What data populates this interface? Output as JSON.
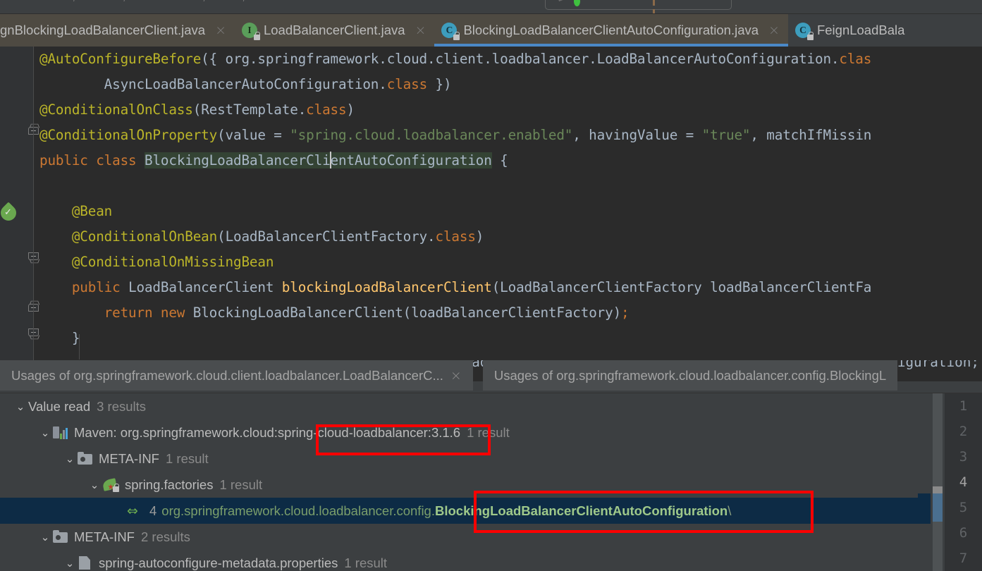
{
  "toolbar": {
    "breadcrumb_parts": [
      "/",
      "/",
      "/",
      "/",
      "/"
    ],
    "run_config_hint": "",
    "icons": [
      "bug-icon",
      "run-icon",
      "pause-icon",
      "chevron-down-icon",
      "minimize-icon"
    ]
  },
  "editor_tabs": [
    {
      "label": "gnBlockingLoadBalancerClient.java",
      "icon": "none",
      "close": "×",
      "active": false,
      "truncated_left": true
    },
    {
      "label": "LoadBalancerClient.java",
      "icon": "interface-icon",
      "close": "×",
      "active": false,
      "truncated_left": false
    },
    {
      "label": "BlockingLoadBalancerClientAutoConfiguration.java",
      "icon": "class-icon",
      "close": "×",
      "active": true,
      "truncated_left": false
    },
    {
      "label": "FeignLoadBala",
      "icon": "class-icon",
      "close": "",
      "active": false,
      "truncated_left": false
    }
  ],
  "code": {
    "lines": [
      [
        {
          "t": "@AutoConfigureBefore",
          "c": "ann"
        },
        {
          "t": "({ ",
          "c": "pn"
        },
        {
          "t": "org.springframework.cloud.client.loadbalancer.LoadBalancerAutoConfiguration",
          "c": "id"
        },
        {
          "t": ".",
          "c": "pn"
        },
        {
          "t": "clas",
          "c": "kw"
        }
      ],
      [
        {
          "t": "        ",
          "c": "pn"
        },
        {
          "t": "AsyncLoadBalancerAutoConfiguration",
          "c": "id"
        },
        {
          "t": ".",
          "c": "pn"
        },
        {
          "t": "class",
          "c": "kw"
        },
        {
          "t": " })",
          "c": "pn"
        }
      ],
      [
        {
          "t": "@ConditionalOnClass",
          "c": "ann"
        },
        {
          "t": "(",
          "c": "pn"
        },
        {
          "t": "RestTemplate",
          "c": "id"
        },
        {
          "t": ".",
          "c": "pn"
        },
        {
          "t": "class",
          "c": "kw"
        },
        {
          "t": ")",
          "c": "pn"
        }
      ],
      [
        {
          "t": "@ConditionalOnProperty",
          "c": "ann"
        },
        {
          "t": "(value = ",
          "c": "pn"
        },
        {
          "t": "\"spring.cloud.loadbalancer.enabled\"",
          "c": "str"
        },
        {
          "t": ", havingValue = ",
          "c": "pn"
        },
        {
          "t": "\"true\"",
          "c": "str"
        },
        {
          "t": ", matchIfMissin",
          "c": "pn"
        }
      ],
      [
        {
          "t": "public",
          "c": "kw"
        },
        {
          "t": " ",
          "c": "pn"
        },
        {
          "t": "class",
          "c": "kw"
        },
        {
          "t": " ",
          "c": "pn"
        },
        {
          "t": "BlockingLoadBalancerCli|entAutoConfiguration",
          "c": "hl"
        },
        {
          "t": " {",
          "c": "pn"
        }
      ],
      [],
      [
        {
          "t": "    ",
          "c": "pn"
        },
        {
          "t": "@Bean",
          "c": "ann"
        }
      ],
      [
        {
          "t": "    ",
          "c": "pn"
        },
        {
          "t": "@ConditionalOnBean",
          "c": "ann"
        },
        {
          "t": "(",
          "c": "pn"
        },
        {
          "t": "LoadBalancerClientFactory",
          "c": "id"
        },
        {
          "t": ".",
          "c": "pn"
        },
        {
          "t": "class",
          "c": "kw"
        },
        {
          "t": ")",
          "c": "pn"
        }
      ],
      [
        {
          "t": "    ",
          "c": "pn"
        },
        {
          "t": "@ConditionalOnMissingBean",
          "c": "ann"
        }
      ],
      [
        {
          "t": "    ",
          "c": "pn"
        },
        {
          "t": "public",
          "c": "kw"
        },
        {
          "t": " ",
          "c": "pn"
        },
        {
          "t": "LoadBalancerClient",
          "c": "id"
        },
        {
          "t": " ",
          "c": "pn"
        },
        {
          "t": "blockingLoadBalancerClient",
          "c": "meth"
        },
        {
          "t": "(",
          "c": "pn"
        },
        {
          "t": "LoadBalancerClientFactory",
          "c": "id"
        },
        {
          "t": " loadBalancerClientFa",
          "c": "pn"
        }
      ],
      [
        {
          "t": "        ",
          "c": "pn"
        },
        {
          "t": "return",
          "c": "kw"
        },
        {
          "t": " ",
          "c": "pn"
        },
        {
          "t": "new",
          "c": "kw"
        },
        {
          "t": " ",
          "c": "pn"
        },
        {
          "t": "BlockingLoadBalancerClient",
          "c": "id"
        },
        {
          "t": "(loadBalancerClientFactory)",
          "c": "pn"
        },
        {
          "t": ";",
          "c": "kw"
        }
      ],
      [
        {
          "t": "    }",
          "c": "pn"
        }
      ]
    ],
    "ghost_line": "import org.springframework.cloud.loadbalancer.config.BlockingLoadBalancerClientAutoConfiguration;"
  },
  "usages_panel": {
    "tabs": [
      {
        "label": "Usages of org.springframework.cloud.client.loadbalancer.LoadBalancerC...",
        "close": "×",
        "selected": true
      },
      {
        "label": "Usages of org.springframework.cloud.loadbalancer.config.BlockingL",
        "close": "",
        "selected": false
      }
    ],
    "tree": [
      {
        "indent": 0,
        "chevron": "⌄",
        "icon": "none",
        "label": "Value read",
        "count": "3 results",
        "selected": false,
        "kind": "group"
      },
      {
        "indent": 1,
        "chevron": "⌄",
        "icon": "maven-icon",
        "label": "Maven: org.springframework.cloud:spring-cloud-loadbalancer:3.1.6",
        "count": "1 result",
        "selected": false,
        "kind": "library"
      },
      {
        "indent": 2,
        "chevron": "⌄",
        "icon": "folder-icon",
        "label": "META-INF",
        "count": "1 result",
        "selected": false,
        "kind": "folder"
      },
      {
        "indent": 3,
        "chevron": "⌄",
        "icon": "spring-icon",
        "label": "spring.factories",
        "count": "1 result",
        "selected": false,
        "kind": "file"
      },
      {
        "indent": 4,
        "chevron": "",
        "icon": "usage-arrow-icon",
        "line_no": "4",
        "prefix": "org.springframework.cloud.loadbalancer.config.",
        "match": "BlockingLoadBalancerClientAutoConfiguration",
        "suffix": "\\",
        "selected": true,
        "kind": "result"
      },
      {
        "indent": 1,
        "chevron": "⌄",
        "icon": "folder-icon",
        "label": "META-INF",
        "count": "2 results",
        "selected": false,
        "kind": "folder"
      },
      {
        "indent": 2,
        "chevron": "⌄",
        "icon": "xml-icon",
        "label": "spring-autoconfigure-metadata.properties",
        "count": "1 result",
        "selected": false,
        "kind": "file-cutoff"
      }
    ]
  },
  "line_numbers": [
    "1",
    "2",
    "3",
    "4",
    "5",
    "6",
    "7"
  ],
  "current_line_number": "4",
  "colors": {
    "editor_bg": "#2b2b2b",
    "panel_bg": "#3c3f41",
    "tab_active_bg": "#4e4a42",
    "tab_underline": "#4a88c7",
    "selection_row": "#0d2b45",
    "annotation_red": "#ff0000",
    "annotation_yellow": "#bbb529",
    "keyword_orange": "#cc7832",
    "string_green": "#6a8759",
    "identifier": "#a9b7c6",
    "method_gold": "#ffc66d"
  }
}
